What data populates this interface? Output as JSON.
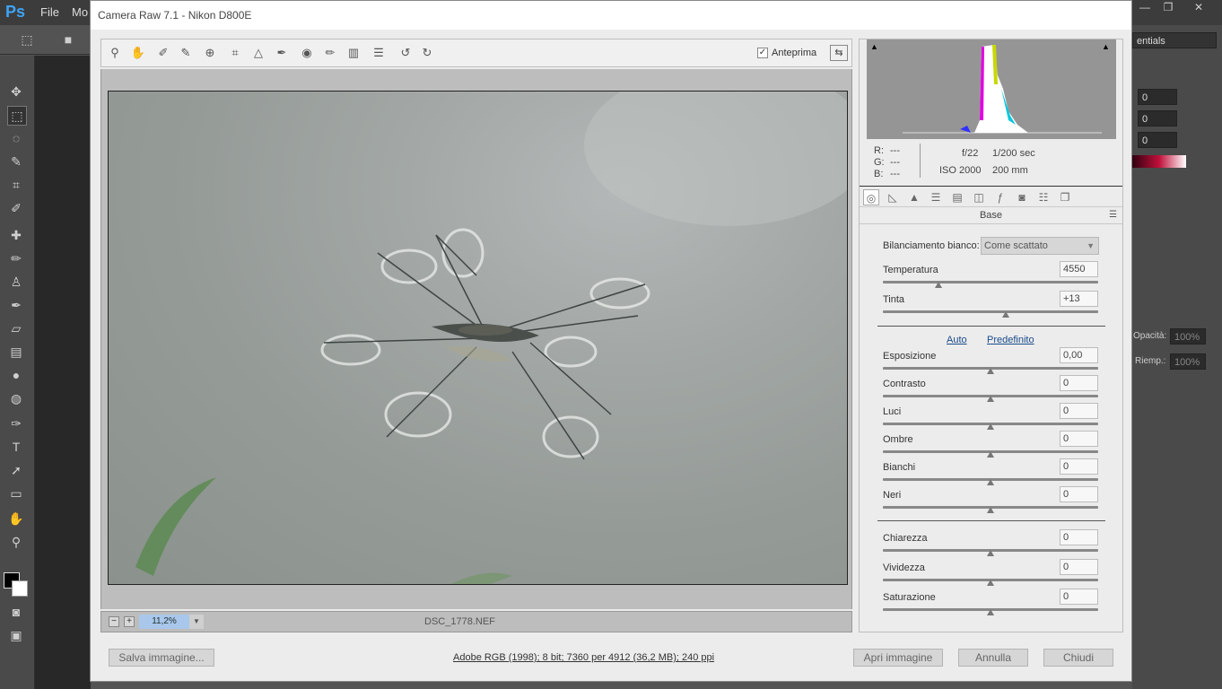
{
  "ps": {
    "logo": "Ps",
    "menus": [
      "File",
      "Mo"
    ],
    "essentials": "entials",
    "fields": [
      "0",
      "0",
      "0"
    ],
    "opacity_label": "Opacità:",
    "opacity_value": "100%",
    "fill_label": "Riemp.:",
    "fill_value": "100%"
  },
  "dialog": {
    "title": "Camera Raw 7.1  -  Nikon D800E",
    "preview_label": "Anteprima",
    "zoom": "11,2%",
    "filename": "DSC_1778.NEF",
    "rgb": {
      "r_label": "R:",
      "g_label": "G:",
      "b_label": "B:",
      "r": "---",
      "g": "---",
      "b": "---"
    },
    "exif": {
      "aperture": "f/22",
      "shutter": "1/200 sec",
      "iso": "ISO 2000",
      "focal": "200 mm"
    },
    "panel_name": "Base",
    "white_balance": {
      "label": "Bilanciamento bianco:",
      "value": "Come scattato"
    },
    "auto_label": "Auto",
    "default_label": "Predefinito",
    "sliders": [
      {
        "label": "Temperatura",
        "value": "4550",
        "pos": 0.26
      },
      {
        "label": "Tinta",
        "value": "+13",
        "pos": 0.57
      },
      {
        "label": "Esposizione",
        "value": "0,00",
        "pos": 0.5
      },
      {
        "label": "Contrasto",
        "value": "0",
        "pos": 0.5
      },
      {
        "label": "Luci",
        "value": "0",
        "pos": 0.5
      },
      {
        "label": "Ombre",
        "value": "0",
        "pos": 0.5
      },
      {
        "label": "Bianchi",
        "value": "0",
        "pos": 0.5
      },
      {
        "label": "Neri",
        "value": "0",
        "pos": 0.5
      },
      {
        "label": "Chiarezza",
        "value": "0",
        "pos": 0.5
      },
      {
        "label": "Vividezza",
        "value": "0",
        "pos": 0.5
      },
      {
        "label": "Saturazione",
        "value": "0",
        "pos": 0.5
      }
    ],
    "buttons": {
      "save": "Salva immagine...",
      "open": "Apri immagine",
      "cancel": "Annulla",
      "done": "Chiudi"
    },
    "workflow": "Adobe RGB (1998); 8 bit; 7360 per 4912 (36,2 MB); 240 ppi"
  }
}
